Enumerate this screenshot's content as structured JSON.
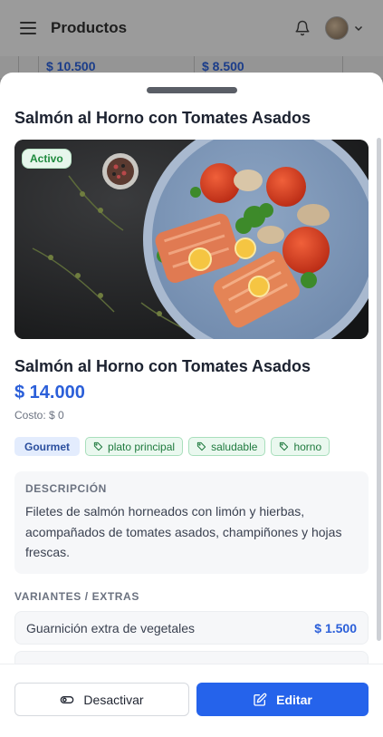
{
  "app": {
    "title": "Productos",
    "background_prices": [
      "$ 10.500",
      "$ 8.500"
    ]
  },
  "sheet": {
    "title": "Salmón al Horno con Tomates Asados",
    "status_badge": "Activo",
    "product_name": "Salmón al Horno con Tomates Asados",
    "price": "$ 14.000",
    "cost": "Costo: $ 0",
    "category": "Gourmet",
    "tags": [
      "plato principal",
      "saludable",
      "horno"
    ],
    "description_label": "DESCRIPCIÓN",
    "description": "Filetes de salmón horneados con limón y hierbas, acompañados de tomates asados, champiñones y hojas frescas.",
    "variants_label": "VARIANTES / EXTRAS",
    "variants": [
      {
        "name": "Guarnición extra de vegetales",
        "price": "$ 1.500"
      }
    ]
  },
  "footer": {
    "deactivate_label": "Desactivar",
    "edit_label": "Editar"
  },
  "colors": {
    "accent": "#2563eb",
    "price": "#2b5fd9",
    "status_green": "#1f8a3e"
  },
  "icons": [
    "menu-icon",
    "bell-icon",
    "chevron-down-icon",
    "tag-icon",
    "eye-off-icon",
    "edit-icon"
  ]
}
